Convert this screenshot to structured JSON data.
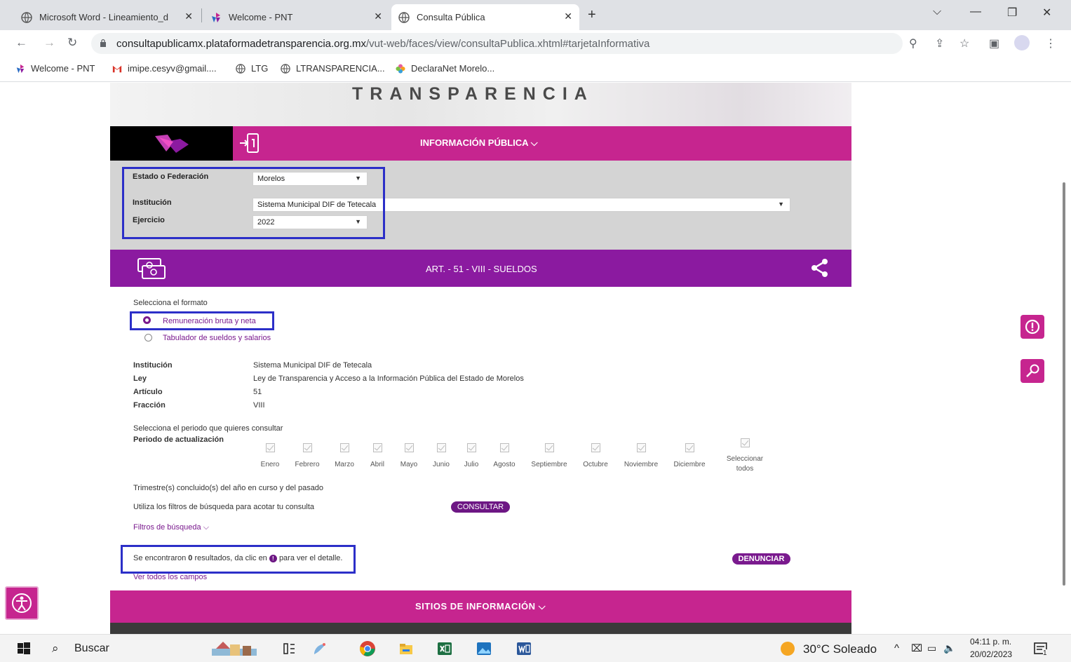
{
  "browser": {
    "tabs": [
      {
        "label": "Microsoft Word - Lineamiento_d",
        "active": false
      },
      {
        "label": "Welcome - PNT",
        "active": false
      },
      {
        "label": "Consulta Pública",
        "active": true
      }
    ],
    "url_host": "consultapublicamx.plataformadetransparencia.org.mx",
    "url_path": "/vut-web/faces/view/consultaPublica.xhtml#tarjetaInformativa",
    "bookmarks": [
      {
        "label": "Welcome - PNT",
        "icon": "pnt-icon"
      },
      {
        "label": "imipe.cesyv@gmail....",
        "icon": "gmail-icon"
      },
      {
        "label": "LTG",
        "icon": "globe-icon"
      },
      {
        "label": "LTRANSPARENCIA...",
        "icon": "globe-icon"
      },
      {
        "label": "DeclaraNet Morelo...",
        "icon": "declaranet-icon"
      }
    ]
  },
  "page": {
    "hero_title": "TRANSPARENCIA",
    "info_bar_title": "INFORMACIÓN PÚBLICA",
    "filters": {
      "state_label": "Estado o Federación",
      "state_value": "Morelos",
      "institution_label": "Institución",
      "institution_value": "Sistema Municipal DIF de Tetecala",
      "year_label": "Ejercicio",
      "year_value": "2022"
    },
    "article_title": "ART. - 51 - VIII - SUELDOS",
    "format": {
      "prompt": "Selecciona el formato",
      "options": [
        "Remuneración bruta y neta",
        "Tabulador de sueldos y salarios"
      ],
      "selected": 0
    },
    "details": [
      {
        "label": "Institución",
        "value": "Sistema Municipal DIF de Tetecala"
      },
      {
        "label": "Ley",
        "value": "Ley de Transparencia y Acceso a la Información Pública del Estado de Morelos"
      },
      {
        "label": "Artículo",
        "value": "51"
      },
      {
        "label": "Fracción",
        "value": "VIII"
      }
    ],
    "period": {
      "prompt": "Selecciona el periodo que quieres consultar",
      "label": "Periodo de actualización",
      "months": [
        "Enero",
        "Febrero",
        "Marzo",
        "Abril",
        "Mayo",
        "Junio",
        "Julio",
        "Agosto",
        "Septiembre",
        "Octubre",
        "Noviembre",
        "Diciembre"
      ],
      "select_all_line1": "Seleccionar",
      "select_all_line2": "todos"
    },
    "quarters_note": "Trimestre(s) concluido(s) del año en curso y del pasado",
    "filter_hint": "Utiliza los filtros de búsqueda para acotar tu consulta",
    "consult_button": "CONSULTAR",
    "search_filters": "Filtros de búsqueda",
    "results": {
      "prefix": "Se encontraron",
      "count": "0",
      "middle": "resultados, da clic en",
      "suffix": "para ver el detalle."
    },
    "report_button": "DENUNCIAR",
    "view_all_fields": "Ver todos los campos",
    "sites_bar_title": "SITIOS DE INFORMACIÓN"
  },
  "taskbar": {
    "search_placeholder": "Buscar",
    "weather": "30°C Soleado",
    "time": "04:11 p. m.",
    "date": "20/02/2023",
    "notification_count": "1"
  },
  "colors": {
    "magenta": "#c6258f",
    "purple": "#8b1aa0",
    "highlight": "#2c2fc8"
  }
}
